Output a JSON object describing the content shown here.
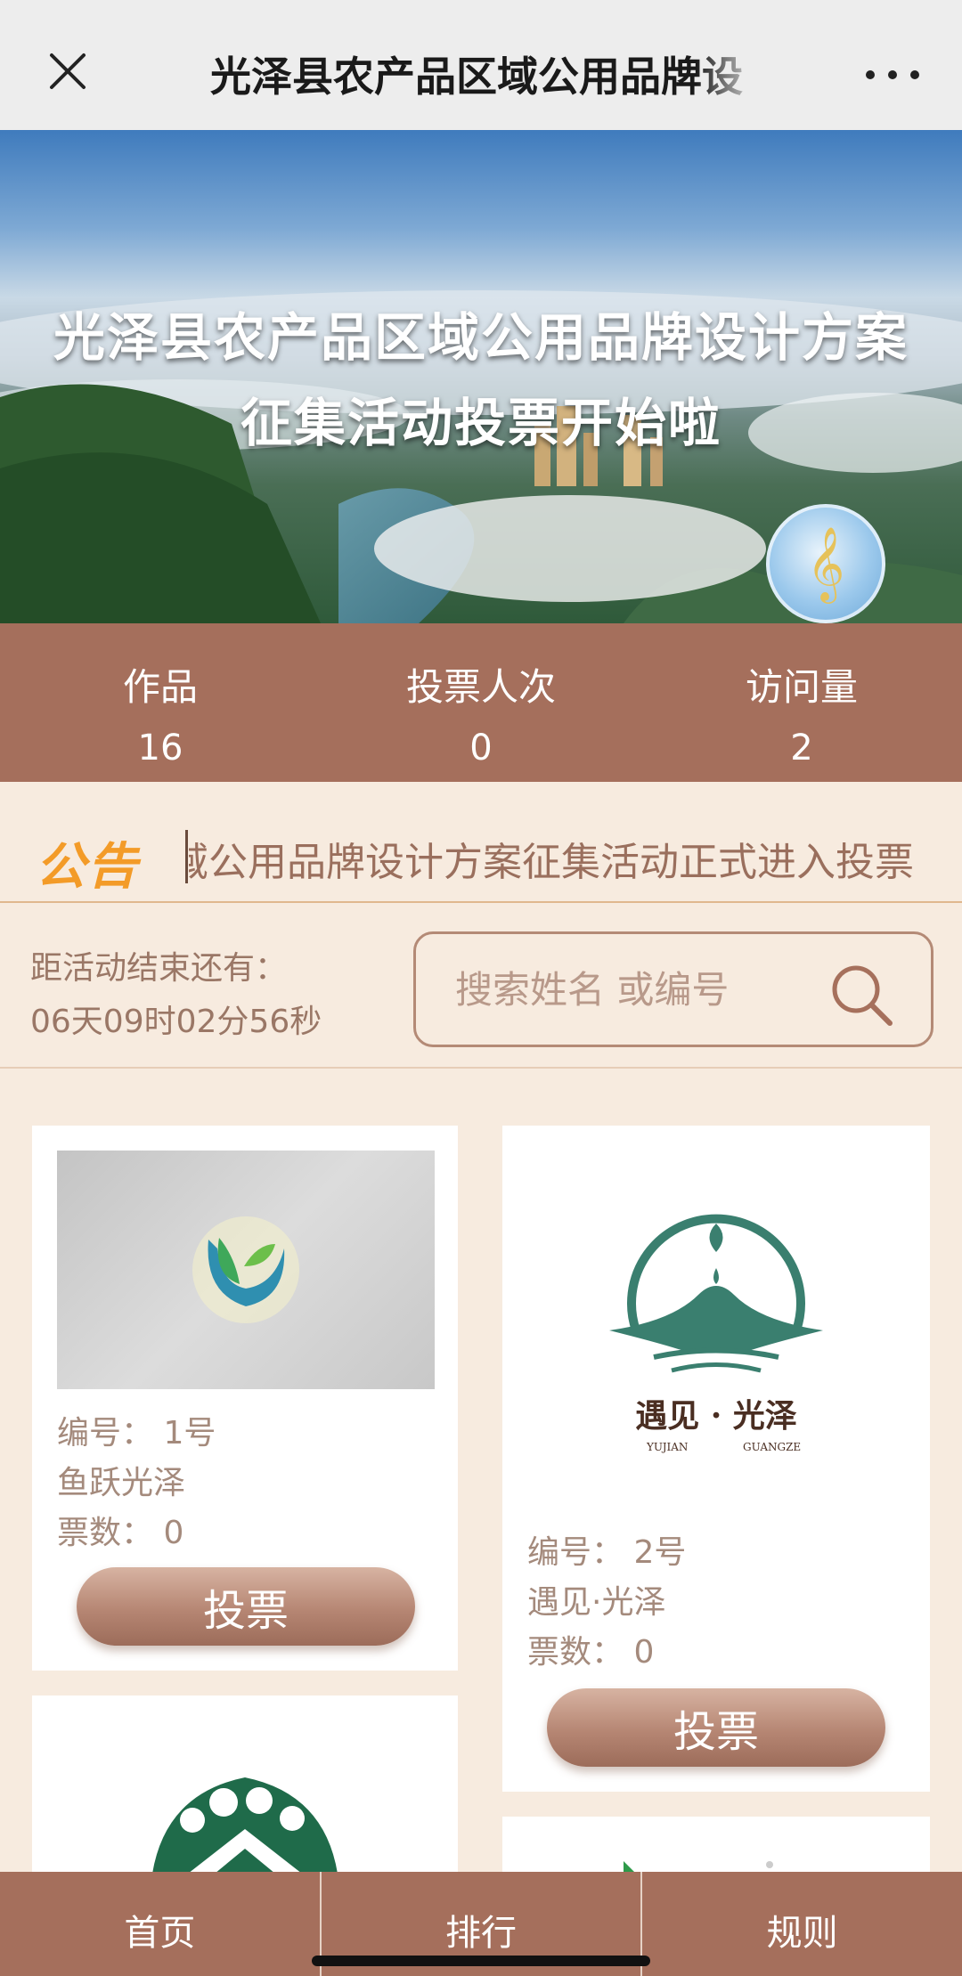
{
  "topbar": {
    "title": "光泽县农产品区域公用品牌设"
  },
  "banner": {
    "title_line1": "光泽县农产品区域公用品牌设计方案",
    "title_line2": "征集活动投票开始啦"
  },
  "stats": [
    {
      "label": "作品",
      "value": "16"
    },
    {
      "label": "投票人次",
      "value": "0"
    },
    {
      "label": "访问量",
      "value": "2"
    }
  ],
  "notice": {
    "badge": "公告",
    "text": "域公用品牌设计方案征集活动正式进入投票"
  },
  "countdown": {
    "label": "距活动结束还有：",
    "value": "06天09时02分56秒"
  },
  "search": {
    "placeholder": "搜索姓名 或编号"
  },
  "entries": [
    {
      "number": "编号：  1号",
      "name": "鱼跃光泽",
      "votes": "票数：  0",
      "vote_label": "投票"
    },
    {
      "number": "编号：  2号",
      "name": "遇见·光泽",
      "votes": "票数：  0",
      "vote_label": "投票",
      "logo_text": "遇见 · 光泽",
      "logo_sub_left": "YUJIAN",
      "logo_sub_right": "GUANGZE"
    }
  ],
  "tabs": [
    {
      "label": "首页"
    },
    {
      "label": "排行"
    },
    {
      "label": "规则"
    }
  ],
  "colors": {
    "accent": "#a56f5c",
    "background": "#f7ebdf",
    "notice_badge": "#f39b28",
    "logo_green": "#3a7f6f"
  }
}
